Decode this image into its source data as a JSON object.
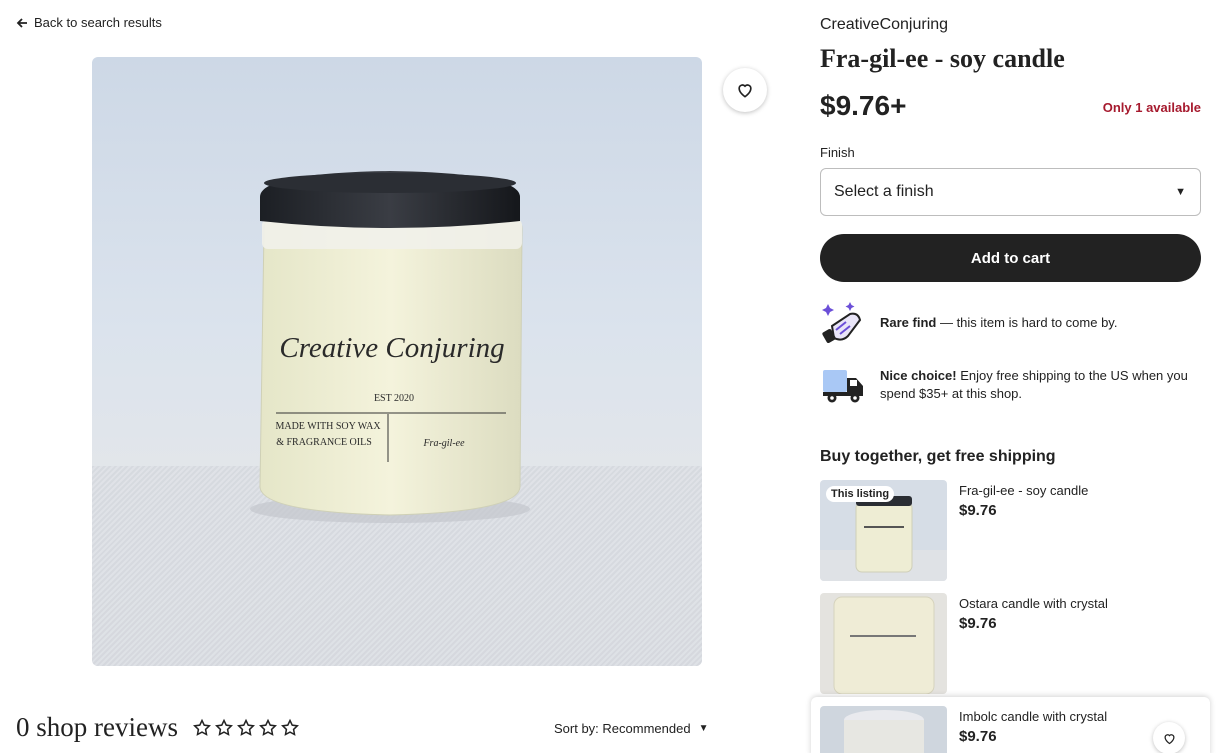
{
  "nav": {
    "back_label": "Back to search results"
  },
  "photo": {
    "label_line1": "Creative Conjuring",
    "label_est": "EST 2020",
    "label_made1": "MADE WITH SOY WAX",
    "label_made2": "& FRAGRANCE OILS",
    "label_scent": "Fra-gil-ee"
  },
  "listing": {
    "shop_name": "CreativeConjuring",
    "title": "Fra-gil-ee - soy candle",
    "price": "$9.76+",
    "stock": "Only 1 available",
    "finish_label": "Finish",
    "finish_placeholder": "Select a finish",
    "add_to_cart": "Add to cart"
  },
  "promos": [
    {
      "bold": "Rare find",
      "text": " — this item is hard to come by.",
      "icon": "sparkle-hand-icon"
    },
    {
      "bold": "Nice choice!",
      "text": " Enjoy free shipping to the US when you spend $35+ at this shop.",
      "icon": "truck-icon"
    }
  ],
  "bundle": {
    "title": "Buy together, get free shipping",
    "this_listing_badge": "This listing",
    "items": [
      {
        "name": "Fra-gil-ee - soy candle",
        "price": "$9.76"
      },
      {
        "name": "Ostara candle with crystal",
        "price": "$9.76"
      },
      {
        "name": "Imbolc candle with crystal",
        "price": "$9.76"
      }
    ]
  },
  "reviews": {
    "count_label": "0 shop reviews",
    "rating": 0,
    "max_rating": 5,
    "sort_label": "Sort by: Recommended"
  },
  "colors": {
    "accent_dark": "#222222",
    "stock_red": "#a61a2e",
    "promo_purple": "#6b4fd8",
    "promo_blue": "#2f6fdb"
  }
}
